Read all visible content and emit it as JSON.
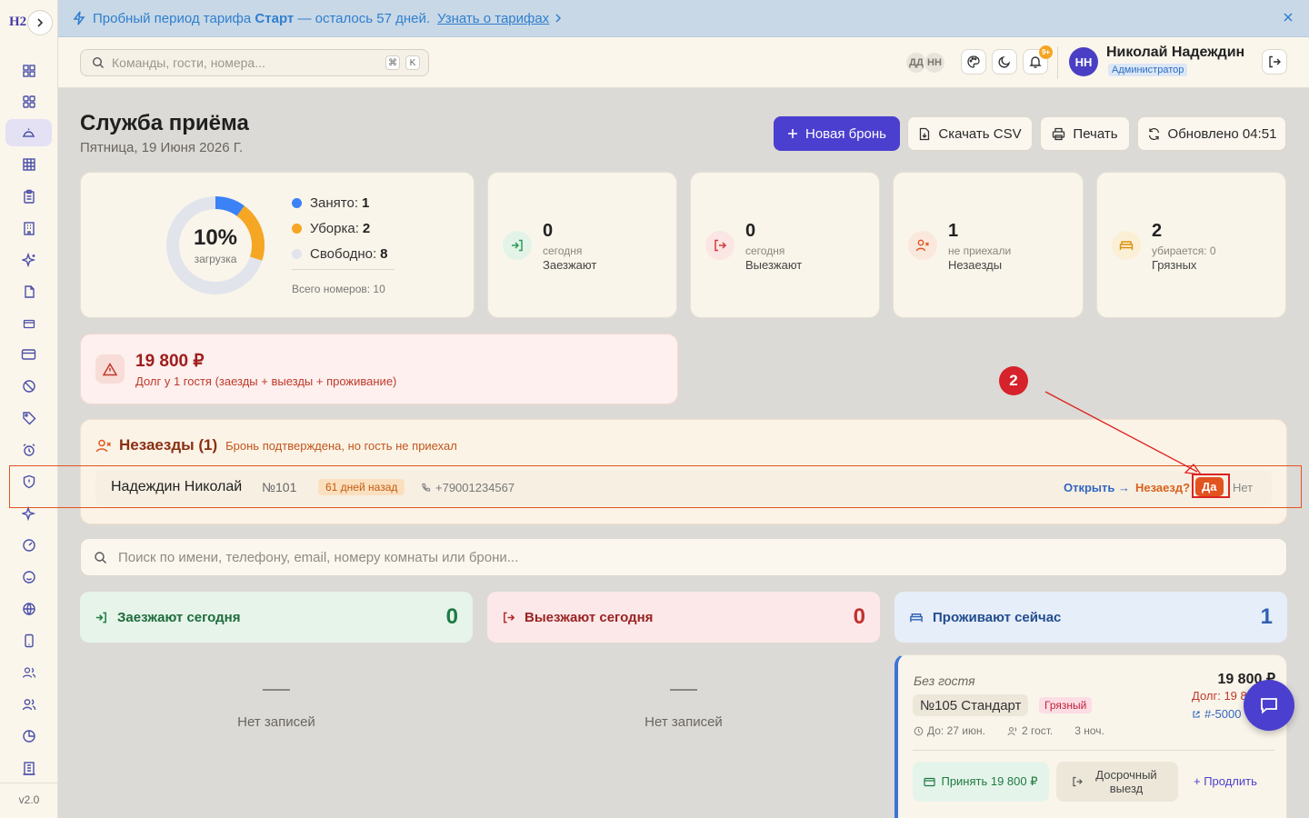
{
  "sidebar": {
    "logo": "H2",
    "version": "v2.0",
    "items": [
      {
        "icon": "dashboard-icon"
      },
      {
        "icon": "grid-icon"
      },
      {
        "icon": "reception-bell-icon"
      },
      {
        "icon": "table-icon"
      },
      {
        "icon": "clipboard-icon"
      },
      {
        "icon": "building-icon"
      },
      {
        "icon": "sparkle-icon"
      },
      {
        "icon": "document-icon"
      },
      {
        "icon": "card-small-icon"
      },
      {
        "icon": "credit-card-icon"
      },
      {
        "icon": "ban-icon"
      },
      {
        "icon": "tag-icon"
      },
      {
        "icon": "alarm-icon"
      },
      {
        "icon": "shield-icon"
      },
      {
        "icon": "sparkles-icon"
      },
      {
        "icon": "gauge-icon"
      },
      {
        "icon": "smile-icon"
      },
      {
        "icon": "globe-icon"
      },
      {
        "icon": "tablet-icon"
      },
      {
        "icon": "users-icon"
      },
      {
        "icon": "team-icon"
      },
      {
        "icon": "pie-chart-icon"
      },
      {
        "icon": "company-icon"
      }
    ]
  },
  "banner": {
    "text_prefix": "Пробный период тарифа",
    "plan": "Старт",
    "text_suffix": "— осталось 57 дней.",
    "link": "Узнать о тарифах"
  },
  "header": {
    "search_placeholder": "Команды, гости, номера...",
    "kbd1": "⌘",
    "kbd2": "K",
    "mini_avatars": [
      "ДД",
      "НН"
    ],
    "notif_badge": "9+",
    "user_initials": "НН",
    "user_name": "Николай Надеждин",
    "user_role": "Администратор"
  },
  "page": {
    "title": "Служба приёма",
    "date": "Пятница, 19 Июня 2026 Г.",
    "btn_new": "Новая бронь",
    "btn_csv": "Скачать CSV",
    "btn_print": "Печать",
    "btn_refresh": "Обновлено 04:51"
  },
  "occupancy": {
    "pct": "10%",
    "label": "загрузка",
    "occupied_label": "Занято:",
    "occupied": "1",
    "cleaning_label": "Уборка:",
    "cleaning": "2",
    "free_label": "Свободно:",
    "free": "8",
    "total": "Всего номеров: 10",
    "colors": {
      "occupied": "#3b82f6",
      "cleaning": "#f5a623",
      "free": "#e2e4ec"
    }
  },
  "stats": [
    {
      "num": "0",
      "sub": "сегодня",
      "name": "Заезжают"
    },
    {
      "num": "0",
      "sub": "сегодня",
      "name": "Выезжают"
    },
    {
      "num": "1",
      "sub": "не приехали",
      "name": "Незаезды"
    },
    {
      "num": "2",
      "sub": "убирается: 0",
      "name": "Грязных"
    }
  ],
  "debt": {
    "amount": "19 800 ₽",
    "text": "Долг у 1 гостя (заезды + выезды + проживание)"
  },
  "noshow": {
    "title": "Незаезды (1)",
    "subtitle": "Бронь подтверждена, но гость не приехал",
    "guest": "Надеждин Николай",
    "room": "№101",
    "ago": "61 дней назад",
    "phone": "+79001234567",
    "open": "Открыть →",
    "question": "Незаезд?",
    "yes": "Да",
    "no": "Нет"
  },
  "search": {
    "placeholder": "Поиск по имени, телефону, email, номеру комнаты или брони..."
  },
  "columns": {
    "arrivals": {
      "label": "Заезжают сегодня",
      "count": "0"
    },
    "departures": {
      "label": "Выезжают сегодня",
      "count": "0"
    },
    "staying": {
      "label": "Проживают сейчас",
      "count": "1"
    },
    "empty_text": "Нет записей"
  },
  "live_card": {
    "guest": "Без гостя",
    "room": "№105 Стандарт",
    "status": "Грязный",
    "until": "До: 27 июн.",
    "guests": "2 гост.",
    "nights": "3 ноч.",
    "price": "19 800 ₽",
    "debt": "Долг: 19 8",
    "booking_link": "#-5000",
    "accept": "Принять 19 800 ₽",
    "early_checkout": "Досрочный выезд",
    "extend": "+ Продлить"
  },
  "annotation": {
    "step": "2"
  }
}
